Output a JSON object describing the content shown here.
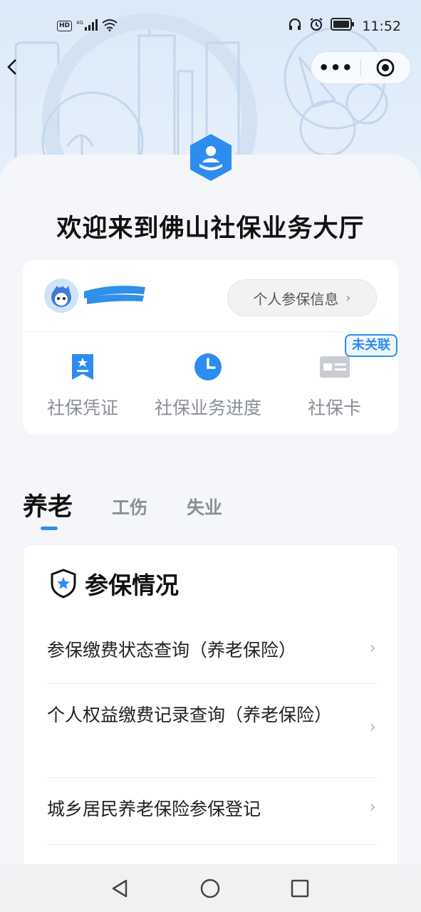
{
  "status_bar": {
    "hd_badge": "HD",
    "signal_label": "4G",
    "time": "11:52",
    "icons": [
      "signal-icon",
      "wifi-icon",
      "headphones-icon",
      "alarm-icon",
      "battery-icon"
    ]
  },
  "nav": {
    "back_icon": "back-chevron-icon",
    "more_label": "•••",
    "close_icon": "close-target-icon"
  },
  "header": {
    "welcome": "欢迎来到佛山社保业务大厅"
  },
  "user_card": {
    "name": "",
    "info_button": "个人参保信息",
    "info_chevron": "›",
    "quick_items": [
      {
        "label": "社保凭证",
        "icon": "certificate-icon"
      },
      {
        "label": "社保业务进度",
        "icon": "clock-icon"
      },
      {
        "label": "社保卡",
        "icon": "card-icon"
      }
    ],
    "badge": "未关联"
  },
  "tabs": [
    {
      "label": "养老",
      "active": true
    },
    {
      "label": "工伤",
      "active": false
    },
    {
      "label": "失业",
      "active": false
    }
  ],
  "section": {
    "title": "参保情况",
    "items": [
      {
        "label": "参保缴费状态查询（养老保险）",
        "arrow": "›"
      },
      {
        "label": "个人权益缴费记录查询（养老保险）",
        "arrow": "›"
      },
      {
        "label": "城乡居民养老保险参保登记",
        "arrow": "›"
      }
    ]
  },
  "colors": {
    "accent": "#2d8cf0",
    "background": "#f4f6f9",
    "header_bg": "#dbe9f8"
  }
}
